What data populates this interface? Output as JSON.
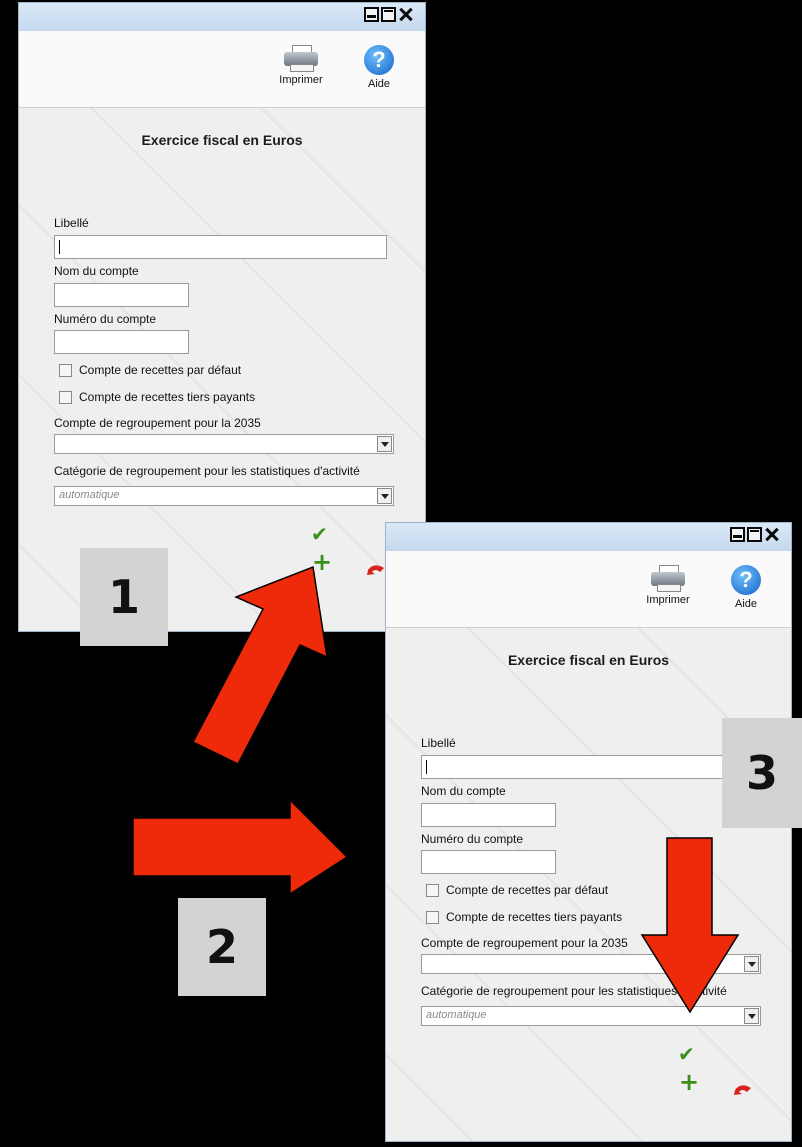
{
  "window": {
    "toolbar": {
      "print_label": "Imprimer",
      "help_label": "Aide",
      "help_glyph": "?"
    },
    "form": {
      "title": "Exercice fiscal en Euros",
      "libelle_label": "Libellé",
      "libelle_value": "",
      "nom_compte_label": "Nom du compte",
      "numero_compte_label": "Numéro du compte",
      "checkbox_default_label": "Compte de recettes par défaut",
      "checkbox_tiers_label": "Compte de recettes tiers payants",
      "regroupement_2035_label": "Compte de regroupement pour la 2035",
      "regroupement_2035_value": "",
      "categorie_label": "Catégorie de regroupement pour les statistiques d'activité",
      "categorie_value": "automatique"
    },
    "actions": {
      "validate_glyph": "✔",
      "add_glyph": "+"
    }
  },
  "steps": [
    "1",
    "2",
    "3"
  ],
  "colors": {
    "arrow": "#ee2a0a",
    "badge": "#d3d3d3",
    "accent_green": "#3a8f1a",
    "undo_red": "#d8231d"
  },
  "icons": [
    "printer-icon",
    "help-icon",
    "checkmark-icon",
    "plus-icon",
    "undo-icon",
    "minimize-icon",
    "maximize-icon",
    "close-icon"
  ]
}
